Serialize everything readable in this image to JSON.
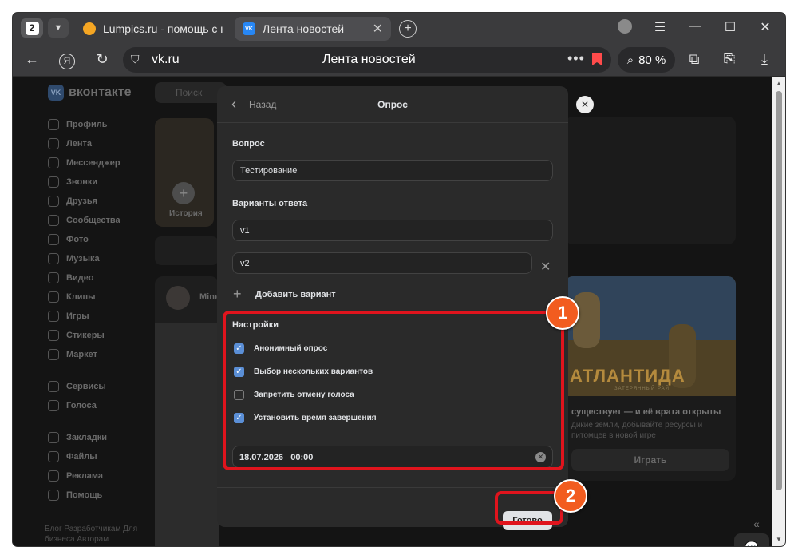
{
  "browser": {
    "tab_count": "2",
    "tabs": [
      {
        "title": "Lumpics.ru - помощь с ком",
        "favicon_color": "#f5a623"
      },
      {
        "title": "Лента новостей",
        "favicon_color": "#2787f5",
        "favicon_text": "VK"
      }
    ],
    "address": {
      "domain": "vk.ru",
      "page_title": "Лента новостей"
    },
    "zoom": "80 %"
  },
  "vk": {
    "logo": "вконтакте",
    "logo_mark": "VK",
    "search_placeholder": "Поиск",
    "sidebar": {
      "group1": [
        "Профиль",
        "Лента",
        "Мессенджер",
        "Звонки",
        "Друзья",
        "Сообщества",
        "Фото",
        "Музыка",
        "Видео",
        "Клипы",
        "Игры",
        "Стикеры",
        "Маркет"
      ],
      "group2": [
        "Сервисы",
        "Голоса"
      ],
      "group3": [
        "Закладки",
        "Файлы",
        "Реклама",
        "Помощь"
      ],
      "footer": "Блог  Разработчикам  Для бизнеса  Авторам"
    },
    "story_label": "История",
    "post_author": "Mine",
    "ad": {
      "brand": "АТЛАНТИДА",
      "tagline": "ЗАТЕРЯННЫЙ РАЙ",
      "text1": "существует — и её врата открыты",
      "text2": "дикие земли, добывайте ресурсы и питомцев в новой игре",
      "button": "Играть"
    }
  },
  "poll_modal": {
    "back": "Назад",
    "title": "Опрос",
    "question_label": "Вопрос",
    "question_value": "Тестирование",
    "answers_label": "Варианты ответа",
    "answers": [
      "v1",
      "v2"
    ],
    "add_option": "Добавить вариант",
    "settings_label": "Настройки",
    "settings": [
      {
        "label": "Анонимный опрос",
        "checked": true
      },
      {
        "label": "Выбор нескольких вариантов",
        "checked": true
      },
      {
        "label": "Запретить отмену голоса",
        "checked": false
      },
      {
        "label": "Установить время завершения",
        "checked": true
      }
    ],
    "end_datetime": "18.07.2026   00:00",
    "done_button": "Готово"
  },
  "annotations": {
    "badge1": "1",
    "badge2": "2",
    "highlight_color": "#e0141d",
    "badge_color": "#f25c1f"
  }
}
